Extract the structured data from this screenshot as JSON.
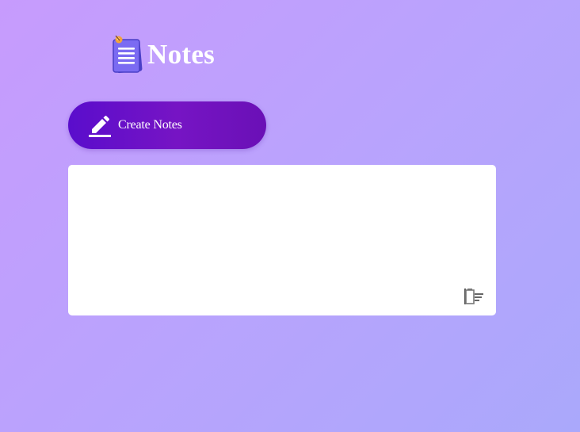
{
  "header": {
    "title": "Notes",
    "logo_icon": "notes-logo-icon"
  },
  "actions": {
    "create_label": "Create Notes",
    "create_icon": "pencil-icon"
  },
  "notes": [
    {
      "text": "",
      "delete_icon": "trash-icon"
    }
  ],
  "colors": {
    "background_start": "#c79bfd",
    "background_end": "#aaa8fb",
    "button_start": "#5a0dcc",
    "button_end": "#6a10b6",
    "card": "#ffffff"
  }
}
